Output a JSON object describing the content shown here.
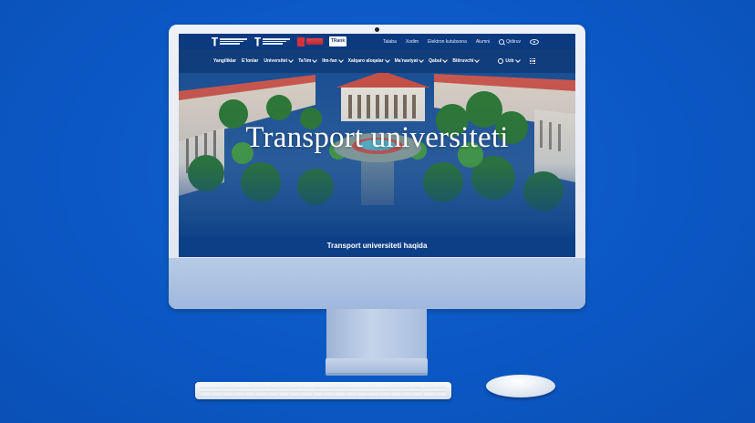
{
  "header": {
    "logos": [
      "tashkent-state-transport-university-logo",
      "tashkent-state-transport-university-logo-2",
      "university-partner-red-logo",
      "rank-badge-logo"
    ],
    "rank_badge_text": "TRank",
    "top_links": [
      "Talaba",
      "Xodim",
      "Elektron kutubxona",
      "Alumni"
    ],
    "search_label": "Qidiruv",
    "accessibility_icon": "eye-icon"
  },
  "nav": {
    "items": [
      {
        "label": "Yangiliklar",
        "dropdown": false
      },
      {
        "label": "E’lonlar",
        "dropdown": false
      },
      {
        "label": "Universitet",
        "dropdown": true
      },
      {
        "label": "Ta’lim",
        "dropdown": true
      },
      {
        "label": "Ilm-fan",
        "dropdown": true
      },
      {
        "label": "Xalqaro aloqalar",
        "dropdown": true
      },
      {
        "label": "Ma’naviyat",
        "dropdown": true
      },
      {
        "label": "Qabul",
        "dropdown": true
      },
      {
        "label": "Bitiruvchi",
        "dropdown": true
      }
    ],
    "language": "Uzb",
    "apps_icon": "grid-icon"
  },
  "hero": {
    "title": "Transport universiteti",
    "caption": "Transport universiteti haqida"
  },
  "colors": {
    "background": "#0b58c4",
    "header": "#0c3a7f",
    "monitor_chin": "#a9c0e0"
  }
}
